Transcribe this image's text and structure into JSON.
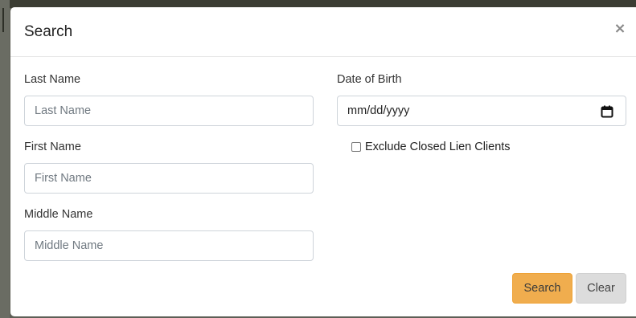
{
  "modal": {
    "title": "Search",
    "close_label": "×"
  },
  "form": {
    "last_name": {
      "label": "Last Name",
      "placeholder": "Last Name",
      "value": ""
    },
    "first_name": {
      "label": "First Name",
      "placeholder": "First Name",
      "value": ""
    },
    "middle_name": {
      "label": "Middle Name",
      "placeholder": "Middle Name",
      "value": ""
    },
    "date_of_birth": {
      "label": "Date of Birth",
      "placeholder": "mm/dd/yyyy",
      "icon": "calendar-icon"
    },
    "exclude_closed": {
      "label": "Exclude Closed Lien Clients",
      "checked": false
    }
  },
  "actions": {
    "search_label": "Search",
    "clear_label": "Clear"
  },
  "colors": {
    "search_button": "#f0ad4e",
    "clear_button": "#dcdcdc",
    "input_border": "#ced4da"
  }
}
